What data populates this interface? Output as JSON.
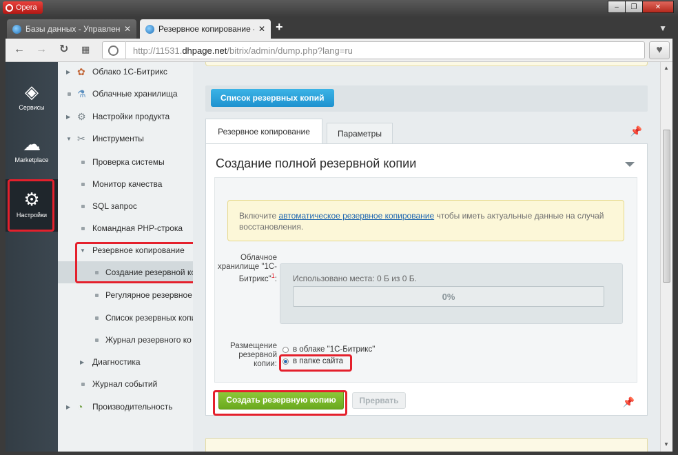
{
  "window": {
    "app_name": "Opera",
    "controls": [
      "‒",
      "❐",
      "✕"
    ]
  },
  "tabs": [
    {
      "label": "Базы данных - Управлени",
      "active": false
    },
    {
      "label": "Резервное копирование -",
      "active": true
    }
  ],
  "address": {
    "prefix": "http://11531.",
    "host": "dhpage.net",
    "path": "/bitrix/admin/dump.php?lang=ru"
  },
  "adminbar": {
    "items": [
      {
        "label": "Сервисы",
        "icon": "layers-icon"
      },
      {
        "label": "Marketplace",
        "icon": "cloud-download-icon"
      },
      {
        "label": "Настройки",
        "icon": "gear-icon"
      }
    ]
  },
  "sidebar": {
    "items": [
      {
        "label": "Облако 1С-Битрикс",
        "level": 1,
        "icon": "cloud-icon"
      },
      {
        "label": "Облачные хранилища",
        "level": 1,
        "icon": "storage-icon"
      },
      {
        "label": "Настройки продукта",
        "level": 1,
        "icon": "gear-icon"
      },
      {
        "label": "Инструменты",
        "level": 1,
        "icon": "tools-icon"
      },
      {
        "label": "Проверка системы",
        "level": 2
      },
      {
        "label": "Монитор качества",
        "level": 2
      },
      {
        "label": "SQL запрос",
        "level": 2
      },
      {
        "label": "Командная PHP-строка",
        "level": 2
      },
      {
        "label": "Резервное копирование",
        "level": 2
      },
      {
        "label": "Создание резервной ко",
        "level": 3,
        "selected": true
      },
      {
        "label": "Регулярное резервное",
        "level": 3
      },
      {
        "label": "Список резервных копи",
        "level": 3
      },
      {
        "label": "Журнал резервного ко",
        "level": 3
      },
      {
        "label": "Диагностика",
        "level": 2
      },
      {
        "label": "Журнал событий",
        "level": 2
      },
      {
        "label": "Производительность",
        "level": 1,
        "icon": "gauge-icon"
      }
    ]
  },
  "main": {
    "list_button": "Список резервных копий",
    "tabs": [
      {
        "label": "Резервное копирование",
        "active": true
      },
      {
        "label": "Параметры",
        "active": false
      }
    ],
    "panel_title": "Создание полной резервной копии",
    "notice": {
      "before": "Включите ",
      "link": "автоматическое резервное копирование",
      "after": " чтобы иметь актуальные данные на случай восстановления."
    },
    "cloud_storage_label": "Облачное хранилище \"1С-Битрикс\"",
    "cloud_storage_req": "1",
    "quota_text": "Использовано места: 0 Б из 0 Б.",
    "progress": {
      "percent_label": "0%",
      "fraction": 0
    },
    "placement_label": "Размещение резервной копии:",
    "placement_options": [
      {
        "label": "в облаке \"1С-Битрикс\"",
        "checked": false
      },
      {
        "label": "в папке сайта",
        "checked": true
      }
    ],
    "create_button": "Создать резервную копию",
    "stop_button": "Прервать"
  },
  "colors": {
    "accent_blue": "#1e92cf",
    "create_green": "#7cbd2a",
    "highlight_red": "#e4202c"
  }
}
